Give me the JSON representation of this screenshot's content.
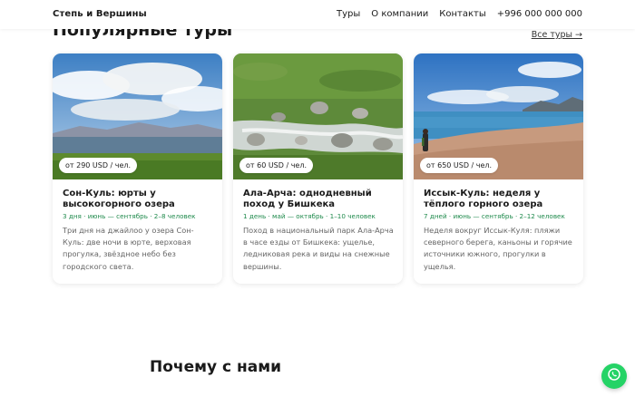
{
  "header": {
    "brand": "Степь и Вершины",
    "nav": [
      "Туры",
      "О компании",
      "Контакты",
      "+996 000 000 000"
    ]
  },
  "section": {
    "title": "Популярные туры",
    "all_link": "Все туры →"
  },
  "cards": [
    {
      "price": "от 290 USD / чел.",
      "title": "Сон-Куль: юрты у высокогорного озера",
      "meta": "3 дня · июнь — сентябрь · 2–8 человек",
      "desc": "Три дня на джайлоо у озера Сон-Куль: две ночи в юрте, верховая прогулка, звёздное небо без городского света."
    },
    {
      "price": "от 60 USD / чел.",
      "title": "Ала-Арча: однодневный поход у Бишкека",
      "meta": "1 день · май — октябрь · 1–10 человек",
      "desc": "Поход в национальный парк Ала-Арча в часе езды от Бишкека: ущелье, ледниковая река и виды на снежные вершины."
    },
    {
      "price": "от 650 USD / чел.",
      "title": "Иссык-Куль: неделя у тёплого горного озера",
      "meta": "7 дней · июнь — сентябрь · 2–12 человек",
      "desc": "Неделя вокруг Иссык-Куля: пляжи северного берега, каньоны и горячие источники южного, прогулки в ущелья."
    }
  ],
  "why": {
    "title": "Почему с нами"
  },
  "colors": {
    "accent_green": "#1f8a4c",
    "whatsapp": "#25d366"
  },
  "icons": {
    "chat": "whatsapp-icon"
  }
}
